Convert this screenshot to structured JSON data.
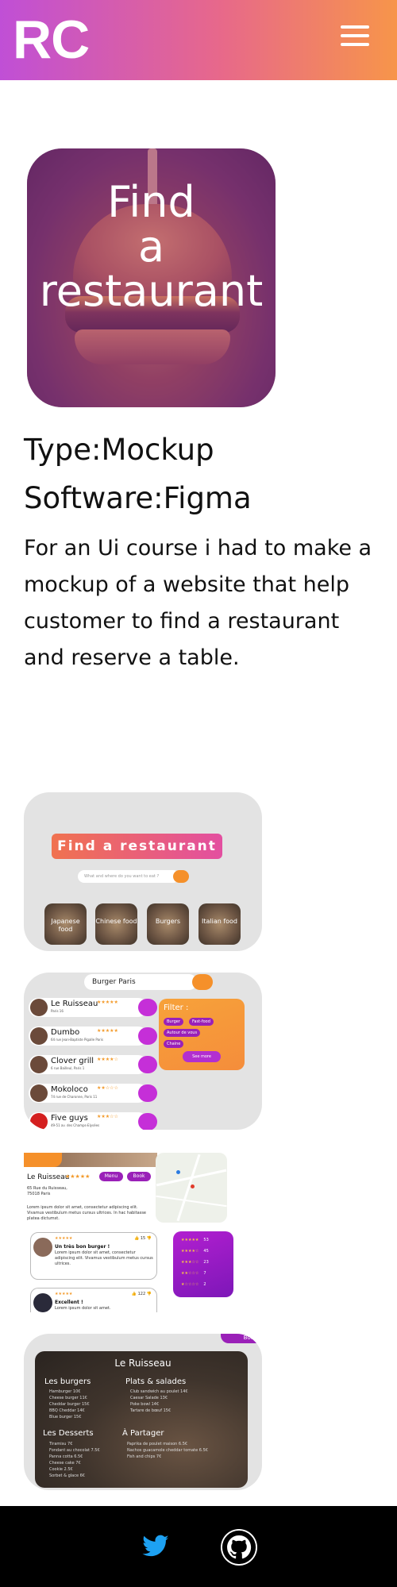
{
  "header": {
    "logo": "RC",
    "menu_icon": "hamburger-icon",
    "gradient": [
      "#c04fd6",
      "#f7954a"
    ]
  },
  "project": {
    "cover_title": "Find\na\nrestaurant",
    "type": "Type:Mockup",
    "software": "Software:Figma",
    "description": "For an Ui course i had to make a mockup of a website that help customer to find a restaurant and reserve a table."
  },
  "mock1": {
    "banner": "Find a restaurant",
    "search_placeholder": "What and where do you want to eat ?",
    "tiles": [
      "Japanese food",
      "Chinese food",
      "Burgers",
      "Italian food"
    ]
  },
  "mock2": {
    "search_value": "Burger Paris",
    "restaurants": [
      {
        "name": "Le Ruisseau",
        "stars": "★★★★★",
        "addr": "Paris 16"
      },
      {
        "name": "Dumbo",
        "stars": "★★★★★",
        "addr": "64 rue Jean-Baptiste Pigalle Paris"
      },
      {
        "name": "Clover grill",
        "stars": "★★★★☆",
        "addr": "6 rue Bailleul, Paris 1"
      },
      {
        "name": "Mokoloco",
        "stars": "★★☆☆☆",
        "addr": "74 rue de Charonne, Paris 11"
      },
      {
        "name": "Five guys",
        "stars": "★★★☆☆",
        "addr": "49-51 av. des Champs-Elysées"
      }
    ],
    "filter": {
      "title": "Filter :",
      "chips": [
        "Burger",
        "Fast-food",
        "Autour de vous",
        "Chaine"
      ],
      "see_more": "See more"
    }
  },
  "mock3": {
    "name": "Le Ruisseau",
    "stars": "★★★★★",
    "menu_btn": "Menu",
    "book_btn": "Book",
    "address": "65 Rue du Ruisseau,\n75018 Paris",
    "lorem": "Lorem ipsum dolor sit amet, consectetur adipiscing elit. Vivamus vestibulum metus cursus ultrices. In hac habitasse platea dictumst.",
    "reviews": [
      {
        "stars": "★★★★★",
        "title": "Un très bon burger !",
        "text": "Lorem ipsum dolor sit amet, consectetur adipiscing elit. Vivamus vestibulum metus cursus ultrices.",
        "votes": "👍 15 👎"
      },
      {
        "stars": "★★★★★",
        "title": "Excellent !",
        "text": "Lorem ipsum dolor sit amet.",
        "votes": "👍 122 👎"
      }
    ],
    "ratings": [
      {
        "stars": "★★★★★",
        "count": "53"
      },
      {
        "stars": "★★★★☆",
        "count": "45"
      },
      {
        "stars": "★★★☆☆",
        "count": "23"
      },
      {
        "stars": "★★☆☆☆",
        "count": "7"
      },
      {
        "stars": "★☆☆☆☆",
        "count": "2"
      }
    ]
  },
  "mock4": {
    "book_btn": "Book",
    "name": "Le Ruisseau",
    "sections": [
      {
        "title": "Les burgers",
        "items": [
          "Hamburger 10€",
          "Cheese burger 11€",
          "Cheddar burger 15€",
          "BBQ Cheddar 14€",
          "Blue burger 15€"
        ]
      },
      {
        "title": "Plats & salades",
        "items": [
          "Club sandwich au poulet 14€",
          "Caesar Salade 13€",
          "Poke bowl 14€",
          "Tartare de bœuf 15€"
        ]
      },
      {
        "title": "Les Desserts",
        "items": [
          "Tiramisu 7€",
          "Fondant au chocolat 7.5€",
          "Panna cotta 6.5€",
          "Cheese cake 7€",
          "Cookie 2.5€",
          "Sorbet & glace 6€"
        ]
      },
      {
        "title": "À Partager",
        "items": [
          "Paprika de poulet maison 6.5€",
          "Nachos guacamole cheddar tomate 6.5€",
          "Fish and chips 7€"
        ]
      }
    ]
  },
  "footer": {
    "twitter_icon": "twitter-icon",
    "github_icon": "github-icon",
    "twitter_color": "#1da1f2"
  }
}
